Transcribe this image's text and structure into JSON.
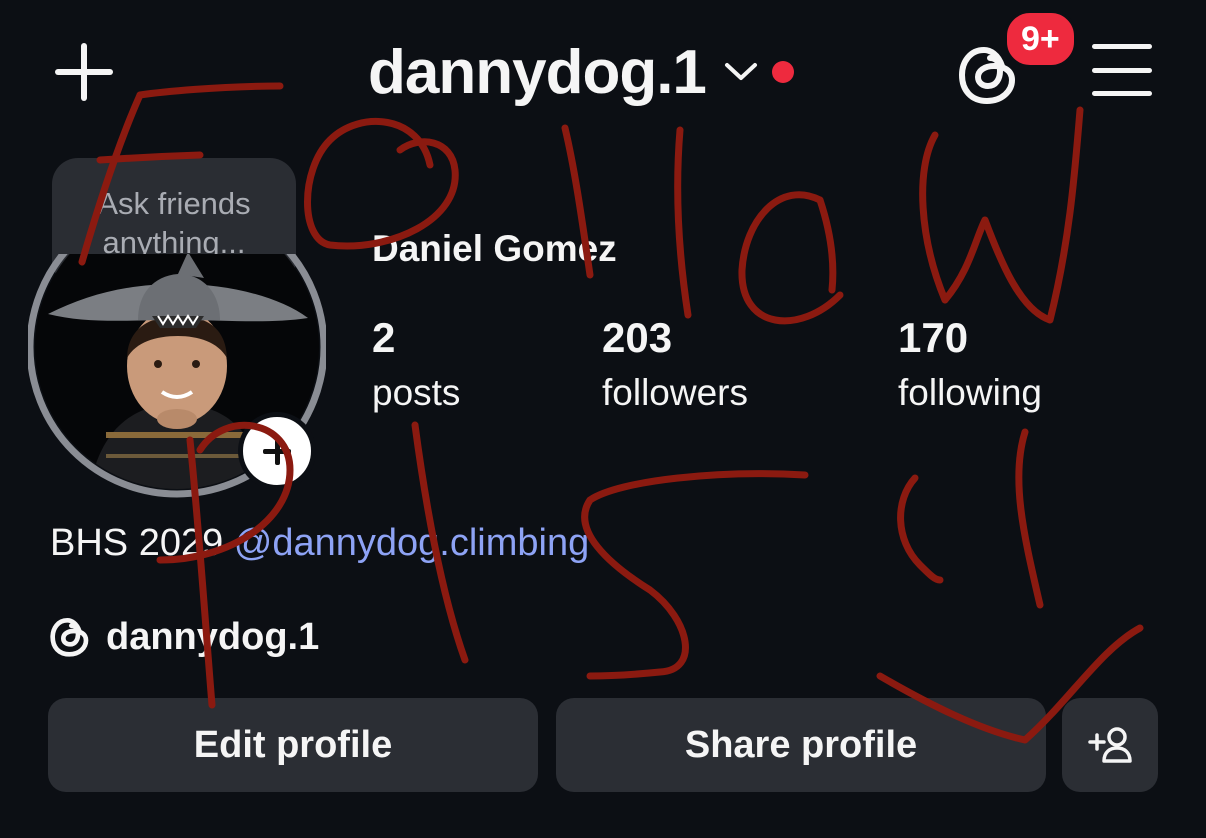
{
  "header": {
    "new_post_icon": "plus-icon",
    "username": "dannydog.1",
    "switch_account_icon": "chevron-down-icon",
    "notification_dot_color": "#ee2a3e",
    "threads_icon": "threads-icon",
    "threads_badge": "9+",
    "menu_icon": "hamburger-menu-icon"
  },
  "note": {
    "placeholder": "Ask friends anything..."
  },
  "profile": {
    "full_name": "Daniel Gomez",
    "stats": [
      {
        "value": "2",
        "label": "posts"
      },
      {
        "value": "203",
        "label": "followers"
      },
      {
        "value": "170",
        "label": "following"
      }
    ],
    "bio_text": "BHS 2029",
    "bio_link": "@dannydog.climbing",
    "threads_handle": "dannydog.1"
  },
  "actions": {
    "edit_label": "Edit profile",
    "share_label": "Share profile",
    "add_person_icon": "add-person-icon"
  },
  "colors": {
    "background": "#0c0f14",
    "button": "#2b2e34",
    "link": "#8ea3f5",
    "scribble": "#8b1a10"
  }
}
